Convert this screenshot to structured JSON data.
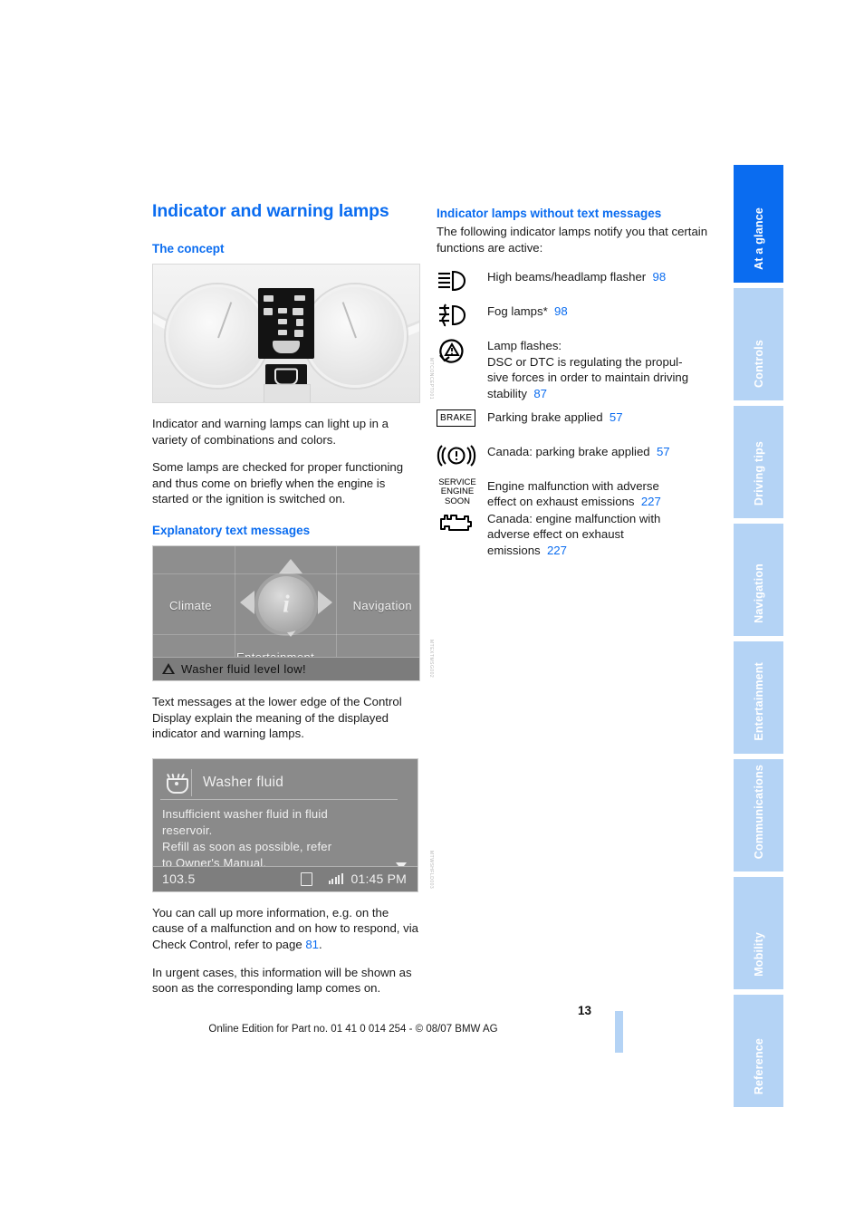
{
  "document": {
    "page_number": "13",
    "footer": "Online Edition for Part no. 01 41 0 014 254 - © 08/07 BMW AG",
    "accent_blue": "#0a6cf0",
    "tab_blue": "#b4d3f5"
  },
  "tabs": [
    {
      "label": "At a glance",
      "active": true
    },
    {
      "label": "Controls",
      "active": false
    },
    {
      "label": "Driving tips",
      "active": false
    },
    {
      "label": "Navigation",
      "active": false
    },
    {
      "label": "Entertainment",
      "active": false
    },
    {
      "label": "Communications",
      "active": false
    },
    {
      "label": "Mobility",
      "active": false
    },
    {
      "label": "Reference",
      "active": false
    }
  ],
  "left_column": {
    "title": "Indicator and warning lamps",
    "section_concept": {
      "heading": "The concept",
      "figure_caption_code": "MTCONCEPT001",
      "paragraphs": [
        "Indicator and warning lamps can light up in a variety of combinations and colors.",
        "Some lamps are checked for proper functioning and thus come on briefly when the engine is started or the ignition is switched on."
      ]
    },
    "section_text_messages": {
      "heading": "Explanatory text messages",
      "figure_caption_code": "MTEXTMSG002",
      "paragraph": "Text messages at the lower edge of the Control Display explain the meaning of the displayed indicator and warning lamps."
    },
    "paragraphs_after": [
      {
        "text_before": "You can call up more information, e.g. on the cause of a malfunction and on how to respond, via Check Control, refer to page ",
        "page_ref": "81",
        "text_after": "."
      },
      {
        "text_before": "In urgent cases, this information will be shown as soon as the corresponding lamp comes on.",
        "page_ref": "",
        "text_after": ""
      }
    ]
  },
  "control_display_menu": {
    "item_left": "Climate",
    "item_right": "Navigation",
    "item_bottom": "Entertainment",
    "center_icon": "info-icon",
    "status_message": "Washer fluid level low!"
  },
  "control_display_message": {
    "header_icon": "washer-fluid-icon",
    "header_title": "Washer fluid",
    "body_lines": [
      "Insufficient washer fluid in fluid",
      "reservoir.",
      "Refill as soon as possible, refer",
      "to Owner's Manual."
    ],
    "footer_frequency": "103.5",
    "footer_media_icon": "cd-icon",
    "footer_signal_icon": "signal-bars-icon",
    "footer_clock": "01:45 PM"
  },
  "right_column": {
    "heading": "Indicator lamps without text messages",
    "intro": "The following indicator lamps notify you that certain functions are active:",
    "lamps": [
      {
        "icon": "high-beam-icon",
        "lines": [
          {
            "text": "High beams/headlamp flasher",
            "page": "98"
          }
        ]
      },
      {
        "icon": "fog-lamp-icon",
        "lines": [
          {
            "text": "Fog lamps*",
            "page": "98"
          }
        ]
      },
      {
        "icon": "dsc-dtc-icon",
        "lines": [
          {
            "text": "Lamp flashes:",
            "page": ""
          },
          {
            "text": "DSC or DTC is regulating the propul-",
            "page": ""
          },
          {
            "text": "sive forces in order to maintain driving",
            "page": ""
          },
          {
            "text": "stability",
            "page": "87"
          }
        ]
      },
      {
        "icon": "brake-text-icon",
        "icon_label": "BRAKE",
        "lines": [
          {
            "text": "Parking brake applied",
            "page": "57"
          }
        ]
      },
      {
        "icon": "parking-brake-canada-icon",
        "lines": [
          {
            "text": "Canada: parking brake applied",
            "page": "57"
          }
        ]
      },
      {
        "icon": "service-engine-soon-icon",
        "icon_label": "SERVICE ENGINE SOON",
        "lines": [
          {
            "text": "Engine malfunction with adverse",
            "page": ""
          },
          {
            "text": "effect on exhaust emissions",
            "page": "227"
          }
        ]
      },
      {
        "icon": "check-engine-icon",
        "lines": [
          {
            "text": "Canada: engine malfunction with",
            "page": ""
          },
          {
            "text": "adverse effect on exhaust",
            "page": ""
          },
          {
            "text": "emissions",
            "page": "227"
          }
        ]
      }
    ]
  }
}
